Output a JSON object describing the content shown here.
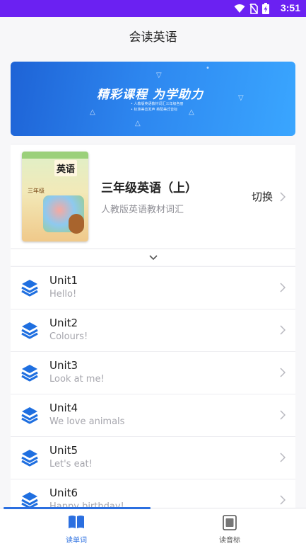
{
  "status_bar": {
    "time": "3:51",
    "icons": [
      "wifi-icon",
      "no-sim-icon",
      "battery-charging-icon"
    ]
  },
  "app_bar": {
    "title": "会读英语"
  },
  "banner": {
    "heading": "精彩课程  为学助力",
    "lines": [
      "• 人教版英语教材词汇三年级各册",
      "• 标准美音发声   英配美式音标"
    ]
  },
  "book": {
    "title": "三年级英语（上）",
    "subtitle": "人教版英语教材词汇",
    "switch_label": "切换",
    "cover": {
      "title": "英语",
      "grade": "三年级"
    }
  },
  "units": [
    {
      "name": "Unit1",
      "desc": "Hello!"
    },
    {
      "name": "Unit2",
      "desc": "Colours!"
    },
    {
      "name": "Unit3",
      "desc": "Look at me!"
    },
    {
      "name": "Unit4",
      "desc": "We love animals"
    },
    {
      "name": "Unit5",
      "desc": "Let's eat!"
    },
    {
      "name": "Unit6",
      "desc": "Happy birthday!"
    }
  ],
  "tabs": [
    {
      "label": "读单词",
      "icon": "open-book-icon",
      "active": true
    },
    {
      "label": "读音标",
      "icon": "phonetics-card-icon",
      "active": false
    }
  ],
  "colors": {
    "status_bar": "#6b21f2",
    "accent": "#2b6fe0",
    "unit_icon": "#1f6fe0"
  }
}
